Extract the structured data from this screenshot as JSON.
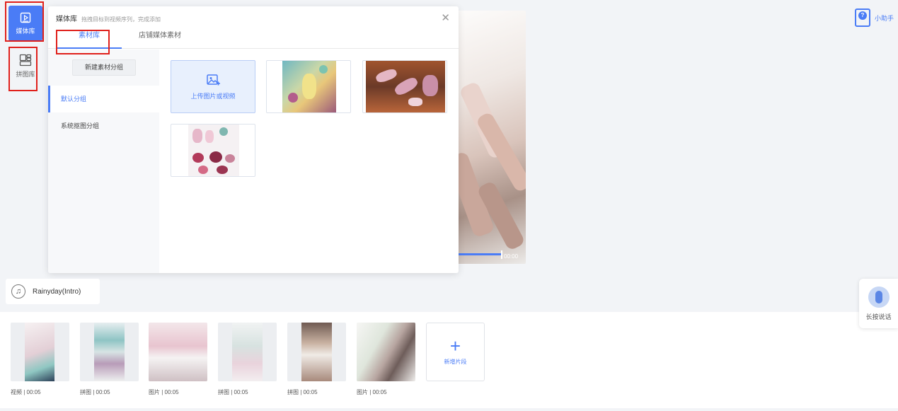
{
  "rail": {
    "media_label": "媒体库",
    "collage_label": "拼图库"
  },
  "panel": {
    "title": "媒体库",
    "hint": "拖拽目标到视频序列，完成添加",
    "close_icon": "close-icon",
    "tabs": [
      "素材库",
      "店铺媒体素材"
    ],
    "new_group_label": "新建素材分组",
    "groups": [
      "默认分组",
      "系统抠图分组"
    ],
    "upload_label": "上传图片或视频"
  },
  "preview": {
    "time": "00:00",
    "progress": 0.85
  },
  "music": {
    "track": "Rainyday(Intro)",
    "icon": "music-note-icon"
  },
  "timeline": {
    "clips": [
      {
        "label": "视频 | 00:05"
      },
      {
        "label": "拼图 | 00:05"
      },
      {
        "label": "图片 | 00:05"
      },
      {
        "label": "拼图 | 00:05"
      },
      {
        "label": "拼图 | 00:05"
      },
      {
        "label": "图片 | 00:05"
      }
    ],
    "add_label": "新增片段"
  },
  "helper": {
    "label": "小助手",
    "icon": "help-book-icon"
  },
  "voice": {
    "label": "长按说话",
    "icon": "microphone-icon"
  },
  "colors": {
    "accent": "#4a7cf6",
    "highlight_box": "#e0201b"
  }
}
